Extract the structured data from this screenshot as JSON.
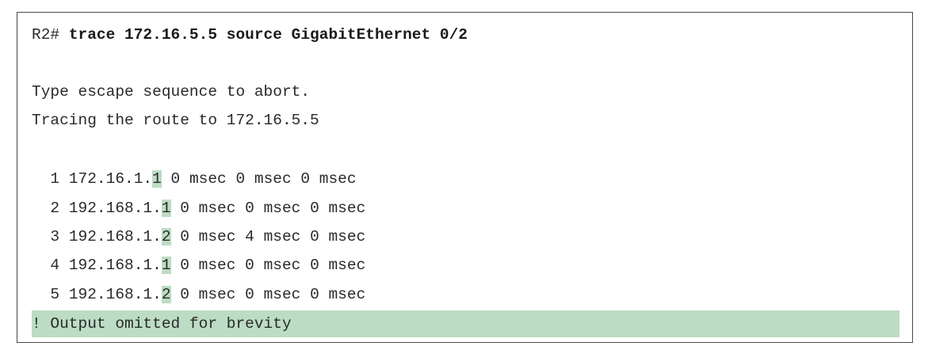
{
  "command": {
    "prompt": "R2#",
    "text": "trace 172.16.5.5 source GigabitEthernet 0/2"
  },
  "messages": [
    "Type escape sequence to abort.",
    "Tracing the route to 172.16.5.5"
  ],
  "hops": [
    {
      "num": "1",
      "addr_prefix": "172.16.1.",
      "addr_last": "1",
      "times": "0 msec 0 msec 0 msec"
    },
    {
      "num": "2",
      "addr_prefix": "192.168.1.",
      "addr_last": "1",
      "times": "0 msec 0 msec 0 msec"
    },
    {
      "num": "3",
      "addr_prefix": "192.168.1.",
      "addr_last": "2",
      "times": "0 msec 4 msec 0 msec"
    },
    {
      "num": "4",
      "addr_prefix": "192.168.1.",
      "addr_last": "1",
      "times": "0 msec 0 msec 0 msec"
    },
    {
      "num": "5",
      "addr_prefix": "192.168.1.",
      "addr_last": "2",
      "times": "0 msec 0 msec 0 msec"
    }
  ],
  "footer": "! Output omitted for brevity",
  "colors": {
    "highlight": "#bcdcc4",
    "border": "#4a4a4a"
  }
}
